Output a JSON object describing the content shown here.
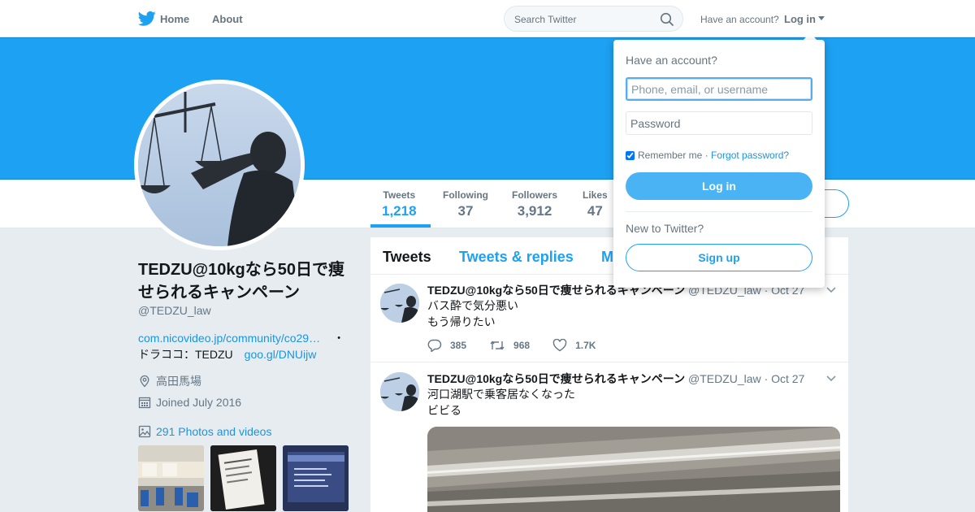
{
  "nav": {
    "logo_icon": "twitter-bird-icon",
    "home_label": "Home",
    "about_label": "About",
    "search_placeholder": "Search Twitter",
    "have_account": "Have an account?",
    "login_label": "Log in"
  },
  "colors": {
    "brand": "#1da1f2",
    "link": "#1b95e0",
    "login_button": "#4ab3f4"
  },
  "profile": {
    "name": "TEDZU@10kgなら50日で痩せられるキャンペーン",
    "handle": "@TEDZU_law",
    "bio_link": "com.nicovideo.jp/community/co29…",
    "bio_dot": "・",
    "bio_text": "ドラココ：TEDZU",
    "bio_link2": "goo.gl/DNUijw",
    "location": "高田馬場",
    "joined": "Joined July 2016",
    "photos_label": "291 Photos and videos"
  },
  "stats": [
    {
      "label": "Tweets",
      "value": "1,218"
    },
    {
      "label": "Following",
      "value": "37"
    },
    {
      "label": "Followers",
      "value": "3,912"
    },
    {
      "label": "Likes",
      "value": "47"
    }
  ],
  "timeline": {
    "tabs": [
      "Tweets",
      "Tweets & replies",
      "M"
    ],
    "tweets": [
      {
        "name": "TEDZU@10kgなら50日で痩せられるキャンペーン",
        "handle": "@TEDZU_law",
        "date": "· Oct 27",
        "line1": "バス酔で気分悪い",
        "line2": "もう帰りたい",
        "replies": "385",
        "retweets": "968",
        "likes": "1.7K"
      },
      {
        "name": "TEDZU@10kgなら50日で痩せられるキャンペーン",
        "handle": "@TEDZU_law",
        "date": "· Oct 27",
        "line1": "河口湖駅で乗客居なくなった",
        "line2": "ビビる"
      }
    ]
  },
  "dropdown": {
    "title": "Have an account?",
    "username_placeholder": "Phone, email, or username",
    "password_placeholder": "Password",
    "remember_label": "Remember me",
    "sep": " · ",
    "forgot_label": "Forgot password?",
    "login_button": "Log in",
    "new_label": "New to Twitter?",
    "signup_button": "Sign up"
  }
}
